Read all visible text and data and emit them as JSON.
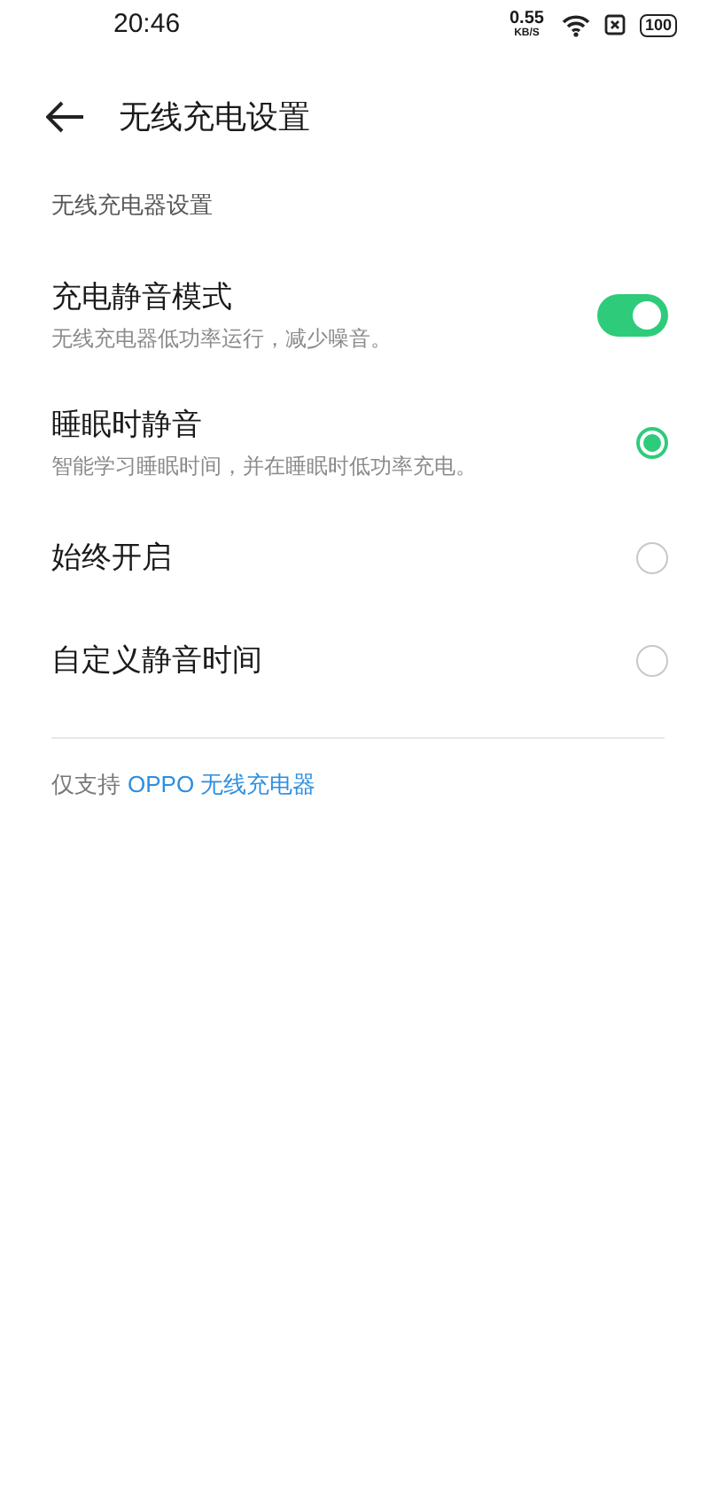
{
  "status_bar": {
    "time": "20:46",
    "speed": "0.55",
    "speed_unit": "KB/S",
    "battery": "100"
  },
  "header": {
    "title": "无线充电设置"
  },
  "section": {
    "label": "无线充电器设置"
  },
  "items": [
    {
      "kind": "switch",
      "title": "充电静音模式",
      "subtitle": "无线充电器低功率运行，减少噪音。",
      "on": true
    },
    {
      "kind": "radio",
      "title": "睡眠时静音",
      "subtitle": "智能学习睡眠时间，并在睡眠时低功率充电。",
      "selected": true
    },
    {
      "kind": "radio",
      "title": "始终开启",
      "selected": false
    },
    {
      "kind": "radio",
      "title": "自定义静音时间",
      "selected": false
    }
  ],
  "footer": {
    "text": "仅支持",
    "link": "OPPO 无线充电器"
  }
}
